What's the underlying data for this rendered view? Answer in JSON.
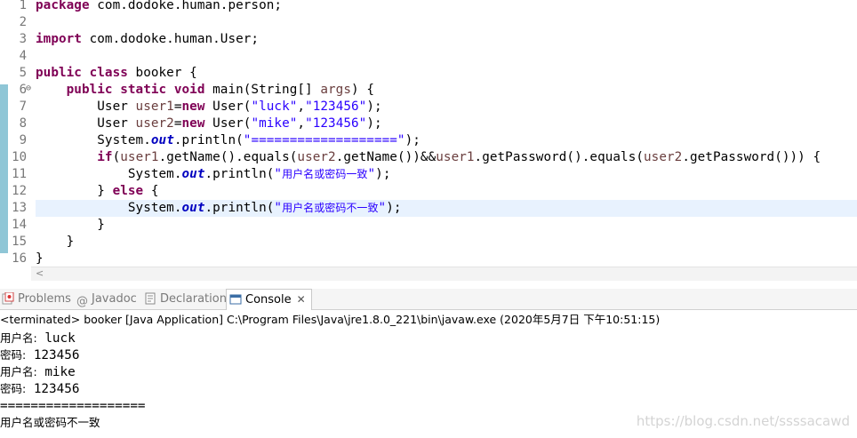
{
  "editor": {
    "line_numbers": [
      "1",
      "2",
      "3",
      "4",
      "5",
      "6",
      "7",
      "8",
      "9",
      "10",
      "11",
      "12",
      "13",
      "14",
      "15",
      "16"
    ],
    "current_line": 13
  },
  "tabs": {
    "problems": "Problems",
    "javadoc": "Javadoc",
    "declaration": "Declaration",
    "console": "Console"
  },
  "console": {
    "status": "<terminated> booker [Java Application] C:\\Program Files\\Java\\jre1.8.0_221\\bin\\javaw.exe (2020年5月7日 下午10:51:15)",
    "output": [
      {
        "label": "用户名:",
        "value": " luck"
      },
      {
        "label": "密码:",
        "value": " 123456"
      },
      {
        "label": "用户名:",
        "value": " mike"
      },
      {
        "label": "密码:",
        "value": " 123456"
      },
      {
        "label": "",
        "value": "==================="
      },
      {
        "label": "用户名或密码不一致",
        "value": ""
      }
    ]
  },
  "watermark": "https://blog.csdn.net/ssssacawd",
  "colors": {
    "keyword": "#7f0055",
    "local_variable": "#6a3e3e",
    "field": "#0000c0",
    "string": "#2a00ff",
    "current_line": "#e8f2fe",
    "gutter_marker": "#8fc6d6"
  }
}
